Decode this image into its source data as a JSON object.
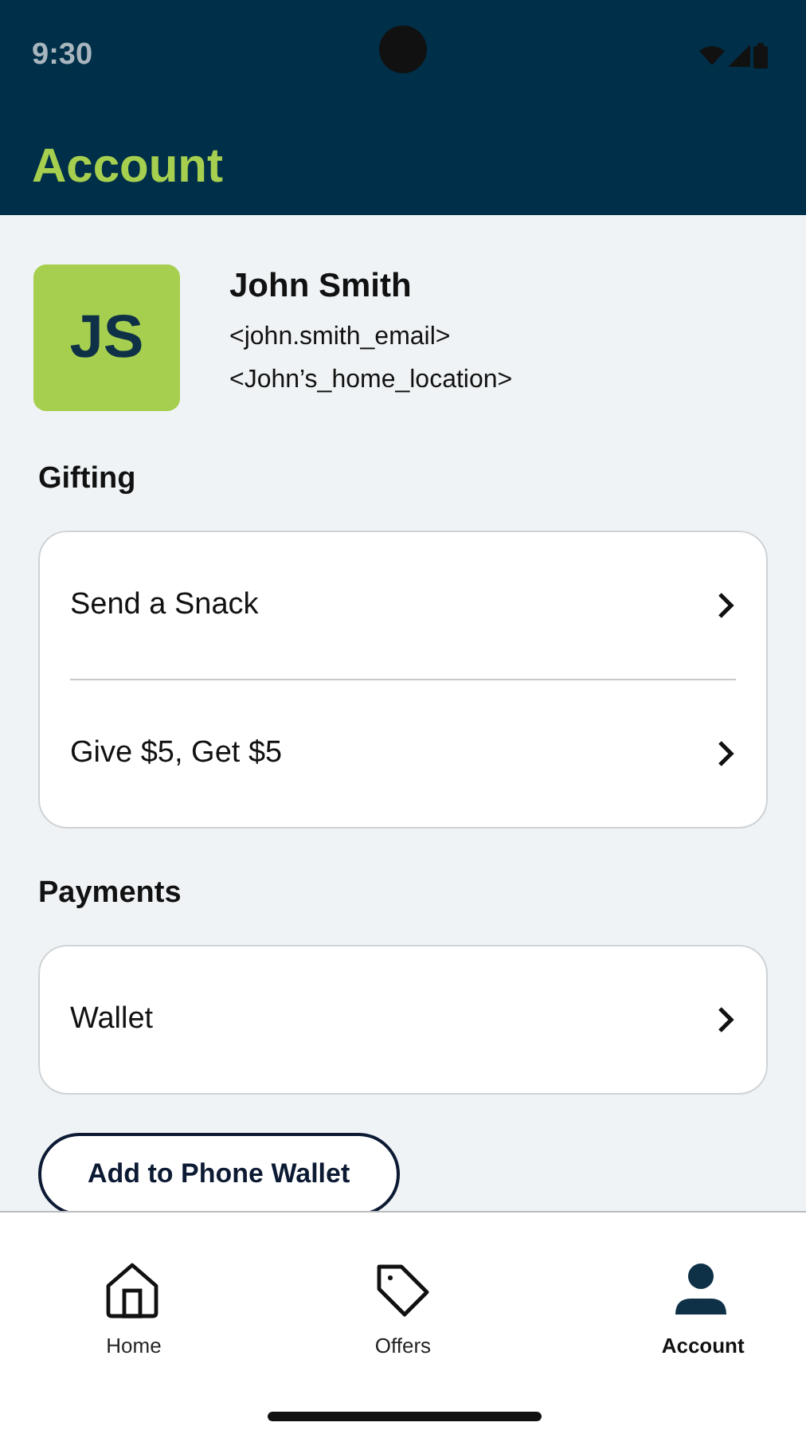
{
  "status_bar": {
    "time": "9:30"
  },
  "header": {
    "title": "Account"
  },
  "profile": {
    "initials": "JS",
    "name": "John Smith",
    "email": "<john.smith_email>",
    "location": "<John’s_home_location>"
  },
  "sections": [
    {
      "title": "Gifting",
      "items": [
        {
          "label": "Send a Snack"
        },
        {
          "label": "Give $5, Get $5"
        }
      ]
    },
    {
      "title": "Payments",
      "items": [
        {
          "label": "Wallet"
        }
      ]
    }
  ],
  "wallet_button": {
    "label": "Add to Phone Wallet"
  },
  "bottom_nav": [
    {
      "kind": "home",
      "label": "Home",
      "selected": false
    },
    {
      "kind": "tag",
      "label": "Offers",
      "selected": false
    },
    {
      "kind": "person",
      "label": "Account",
      "selected": true
    }
  ]
}
